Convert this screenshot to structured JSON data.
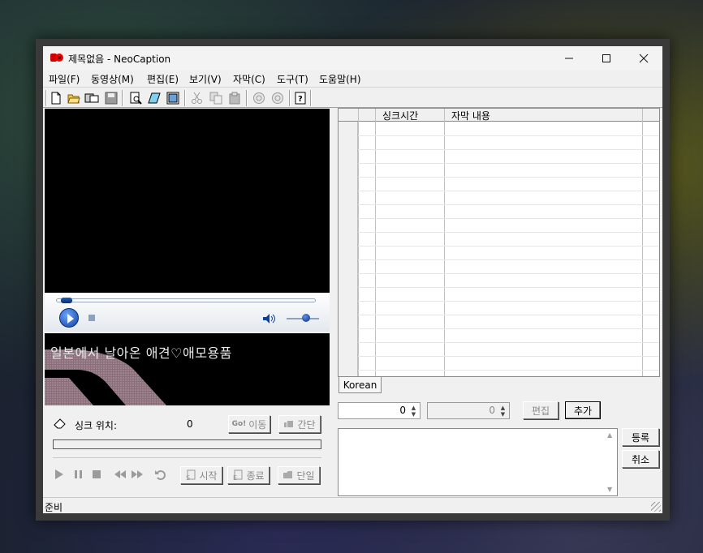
{
  "window": {
    "title": "제목없음 - NeoCaption",
    "minimize": "—",
    "maximize": "☐",
    "close": "✕"
  },
  "menu": [
    {
      "label": "파일(F)"
    },
    {
      "label": "동영상(M)"
    },
    {
      "label": "편집(E)"
    },
    {
      "label": "보기(V)"
    },
    {
      "label": "자막(C)"
    },
    {
      "label": "도구(T)"
    },
    {
      "label": "도움말(H)"
    }
  ],
  "toolbar": {
    "icons": [
      "new-file-icon",
      "open-folder-icon",
      "save-icon",
      "disk-icon",
      "preview-icon",
      "note-icon",
      "frame-icon",
      "cut-icon",
      "copy-icon",
      "paste-icon",
      "rewind-icon",
      "forward-icon",
      "help-icon"
    ]
  },
  "player": {
    "seek_progress": 0.02,
    "volume_level": 0.6
  },
  "preview": {
    "subtitle_text": "일본에서 날아온 애견♡애모용품"
  },
  "sync": {
    "label": "싱크 위치:",
    "value": "0",
    "go_button": "이동",
    "go_prefix": "Go!",
    "pause_button": "간단"
  },
  "controls": {
    "start_button": "시작",
    "end_button": "종료",
    "single_button": "단일"
  },
  "grid": {
    "columns": [
      "싱크시간",
      "자막 내용"
    ],
    "rows": []
  },
  "lang_tab": "Korean",
  "editor": {
    "spin1_value": "0",
    "spin2_value": "0",
    "edit_button": "편집",
    "add_button": "추가",
    "register_button": "등록",
    "cancel_button": "취소"
  },
  "status": {
    "text": "준비"
  },
  "colors": {
    "window_bg": "#f0f0f0",
    "accent": "#0c3fa0",
    "video_bg": "#000000"
  }
}
